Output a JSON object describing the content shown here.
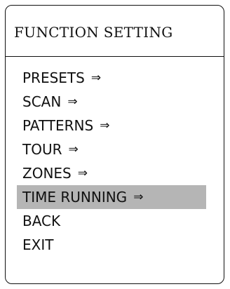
{
  "menu": {
    "title": "FUNCTION SETTING",
    "items": [
      {
        "label": "PRESETS",
        "arrow": "⇒"
      },
      {
        "label": "SCAN",
        "arrow": "⇒"
      },
      {
        "label": "PATTERNS",
        "arrow": "⇒"
      },
      {
        "label": "TOUR",
        "arrow": "⇒"
      },
      {
        "label": "ZONES",
        "arrow": "⇒"
      },
      {
        "label": "TIME RUNNING",
        "arrow": "⇒"
      },
      {
        "label": "BACK",
        "arrow": ""
      },
      {
        "label": "EXIT",
        "arrow": ""
      }
    ],
    "selected_index": 5,
    "highlight_color": "#b5b5b5"
  }
}
